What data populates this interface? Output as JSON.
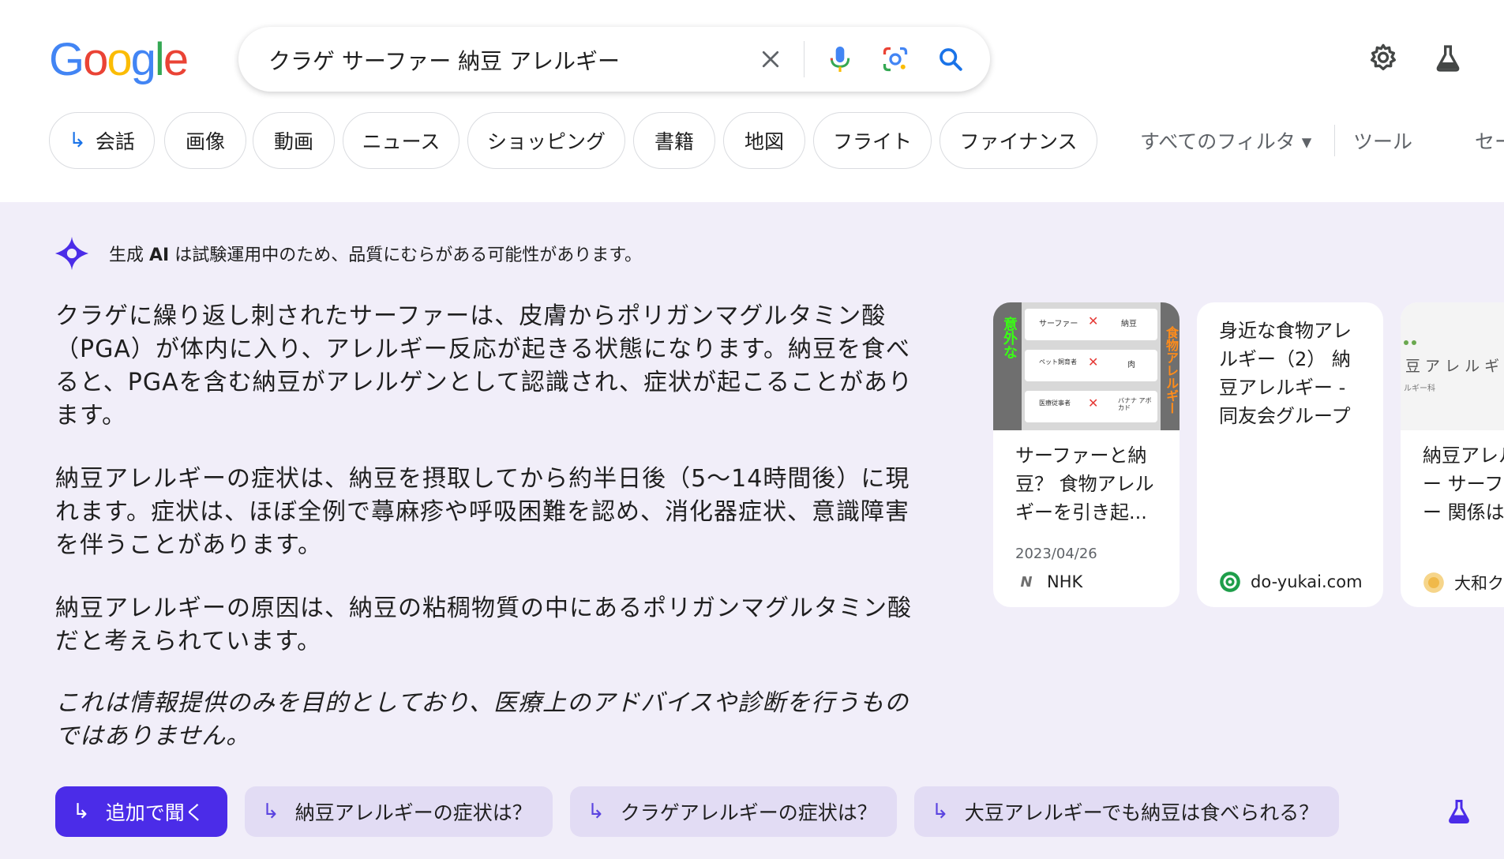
{
  "logo": {
    "text": "Google"
  },
  "search": {
    "query": "クラゲ サーファー 納豆 アレルギー",
    "clear_icon": "close-icon",
    "voice_icon": "mic-icon",
    "lens_icon": "lens-icon",
    "search_icon": "search-icon"
  },
  "toolbar": {
    "settings_icon": "gear-icon",
    "labs_icon": "flask-icon"
  },
  "chips": [
    {
      "label": "会話",
      "icon": "arrow-icon"
    },
    {
      "label": "画像"
    },
    {
      "label": "動画"
    },
    {
      "label": "ニュース"
    },
    {
      "label": "ショッピング"
    },
    {
      "label": "書籍"
    },
    {
      "label": "地図"
    },
    {
      "label": "フライト"
    },
    {
      "label": "ファイナンス"
    }
  ],
  "filters": {
    "all_filters": "すべてのフィルタ ▾",
    "tools": "ツール",
    "more": "セー"
  },
  "ai": {
    "disclaimer_prefix": "生成",
    "disclaimer_bold": "AI",
    "disclaimer_suffix": "は試験運用中のため、品質にむらがある可能性があります。",
    "paragraphs": [
      "クラゲに繰り返し刺されたサーファーは、皮膚からポリガンマグルタミン酸（PGA）が体内に入り、アレルギー反応が起きる状態になります。納豆を食べると、PGAを含む納豆がアレルゲンとして認識され、症状が起こることがあります。",
      "納豆アレルギーの症状は、納豆を摂取してから約半日後（5〜14時間後）に現れます。症状は、ほぼ全例で蕁麻疹や呼吸困難を認め、消化器症状、意識障害を伴うことがあります。",
      "納豆アレルギーの原因は、納豆の粘稠物質の中にあるポリガンマグルタミン酸だと考えられています。"
    ],
    "note": "これは情報提供のみを目的としており、医療上のアドバイスや診断を行うものではありません。"
  },
  "sources": [
    {
      "title": "サーファーと納豆？ 食物アレルギーを引き起...",
      "date": "2023/04/26",
      "source": "NHK",
      "favicon": "N"
    },
    {
      "title": "身近な食物アレルギー（2） 納豆アレルギー - 同友会グループ",
      "date": "",
      "source": "do-yukai.com",
      "favicon": ""
    },
    {
      "title": "納豆アレルギー サーファー 関係は？",
      "date": "",
      "source": "大和ク",
      "favicon": ""
    }
  ],
  "thumb1": {
    "side_left": "意外な",
    "side_right": "食物アレルギー",
    "rows": [
      {
        "left": "サーファー",
        "right": "納豆"
      },
      {
        "left": "ペット飼育者",
        "right": "肉"
      },
      {
        "left": "医療従事者",
        "right": "バナナ アボカド"
      }
    ]
  },
  "thumb3": {
    "heading": "豆 ア レ ル ギ",
    "sub": "ルギー科"
  },
  "followups": [
    {
      "label": "追加で聞く",
      "primary": true
    },
    {
      "label": "納豆アレルギーの症状は？"
    },
    {
      "label": "クラゲアレルギーの症状は？"
    },
    {
      "label": "大豆アレルギーでも納豆は食べられる？"
    }
  ],
  "colors": {
    "ai_bg": "#f1eef9",
    "accent": "#4b2ce8",
    "chip_bg": "#e2dcf4"
  }
}
